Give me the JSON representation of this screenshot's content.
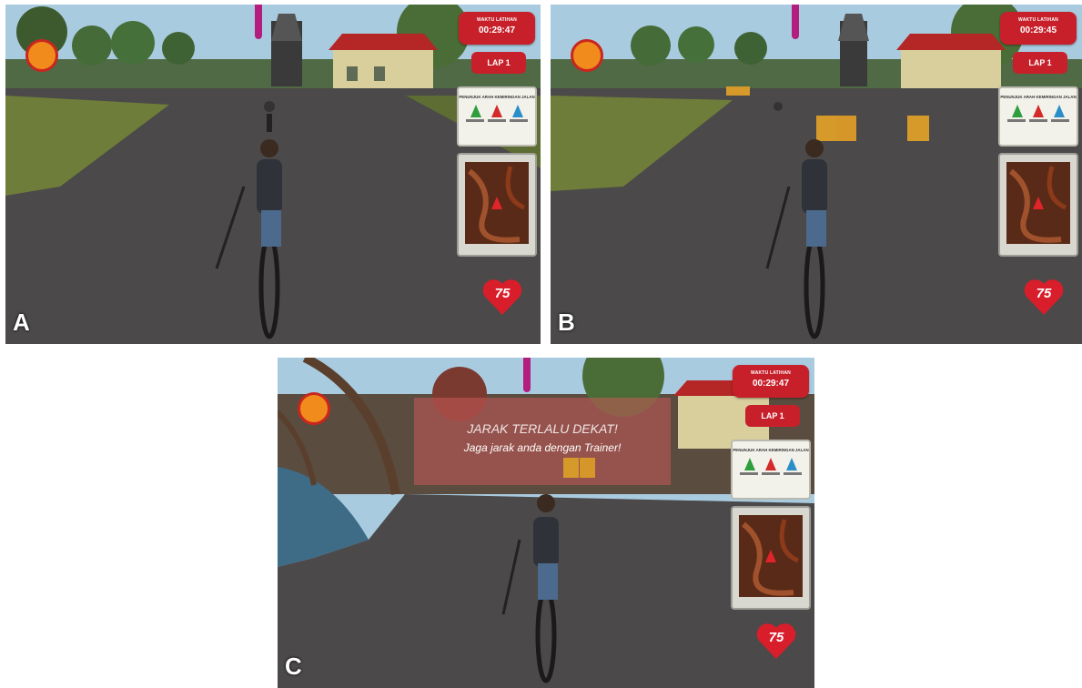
{
  "panels": [
    {
      "letter": "A",
      "timer_label": "WAKTU LATIHAN",
      "timer": "00:29:47",
      "lap": "LAP 1",
      "legend_title": "PENUNJUK ARAH KEMIRINGAN JALAN",
      "heart_rate": "75"
    },
    {
      "letter": "B",
      "timer_label": "WAKTU LATIHAN",
      "timer": "00:29:45",
      "lap": "LAP 1",
      "legend_title": "PENUNJUK ARAH KEMIRINGAN JALAN",
      "heart_rate": "75"
    },
    {
      "letter": "C",
      "timer_label": "WAKTU LATIHAN",
      "timer": "00:29:47",
      "lap": "LAP 1",
      "legend_title": "PENUNJUK ARAH KEMIRINGAN JALAN",
      "heart_rate": "75",
      "warning_title": "JARAK TERLALU DEKAT!",
      "warning_message": "Jaga jarak anda dengan Trainer!"
    }
  ],
  "colors": {
    "hud_red": "#c8202a",
    "sky": "#a9cbe0",
    "road": "#4a4848",
    "grass": "#6f7d3a"
  },
  "icons": [
    "clock-icon",
    "heart-icon",
    "up-arrow-green-icon",
    "up-arrow-red-icon",
    "up-arrow-blue-icon",
    "map-position-icon"
  ]
}
